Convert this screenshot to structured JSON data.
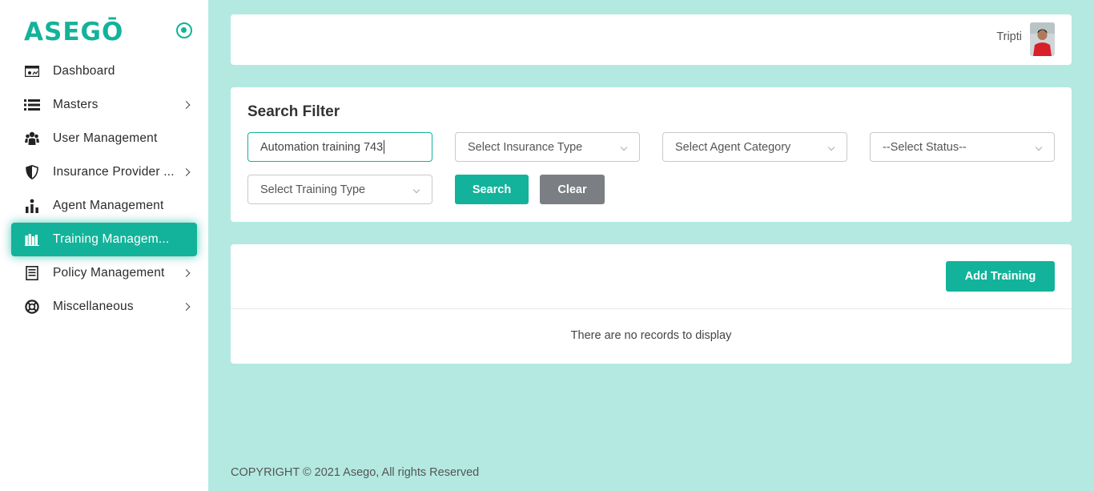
{
  "brand": {
    "name": "ASEGŌ",
    "accent": "#12b39a"
  },
  "sidebar": {
    "items": [
      {
        "label": "Dashboard",
        "icon": "dashboard-icon",
        "has_submenu": false
      },
      {
        "label": "Masters",
        "icon": "list-icon",
        "has_submenu": true
      },
      {
        "label": "User Management",
        "icon": "users-icon",
        "has_submenu": false
      },
      {
        "label": "Insurance Provider ...",
        "icon": "shield-icon",
        "has_submenu": true
      },
      {
        "label": "Agent Management",
        "icon": "agent-chart-icon",
        "has_submenu": false
      },
      {
        "label": "Training Managem...",
        "icon": "books-icon",
        "has_submenu": false,
        "active": true
      },
      {
        "label": "Policy Management",
        "icon": "document-icon",
        "has_submenu": true
      },
      {
        "label": "Miscellaneous",
        "icon": "lifebuoy-icon",
        "has_submenu": true
      }
    ]
  },
  "header": {
    "user_name": "Tripti"
  },
  "filter": {
    "title": "Search Filter",
    "search_value": "Automation training 743",
    "insurance_type_placeholder": "Select Insurance Type",
    "agent_category_placeholder": "Select Agent Category",
    "status_placeholder": "--Select Status--",
    "training_type_placeholder": "Select Training Type",
    "search_label": "Search",
    "clear_label": "Clear"
  },
  "records": {
    "add_label": "Add Training",
    "empty_message": "There are no records to display"
  },
  "footer": {
    "copyright": "COPYRIGHT © 2021 Asego, All rights Reserved"
  }
}
